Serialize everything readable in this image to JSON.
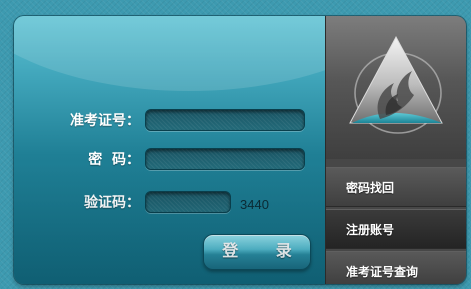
{
  "form": {
    "exam_id_label": "准考证号：",
    "exam_id_value": "",
    "password_label": "密  码：",
    "password_value": "",
    "captcha_label": "验证码：",
    "captcha_value": "",
    "captcha_code": "3440",
    "login_button": "登 录"
  },
  "side_menu": {
    "items": [
      {
        "label": "密码找回"
      },
      {
        "label": "注册账号"
      },
      {
        "label": "准考证号查询"
      }
    ]
  },
  "logo": {
    "icon": "flame-triangle-logo-icon"
  },
  "colors": {
    "background": "#3d9ab0",
    "form_panel": "#1f7f95",
    "side_panel": "#474747",
    "login_button": "#58c0d3",
    "text": "#ffffff"
  }
}
